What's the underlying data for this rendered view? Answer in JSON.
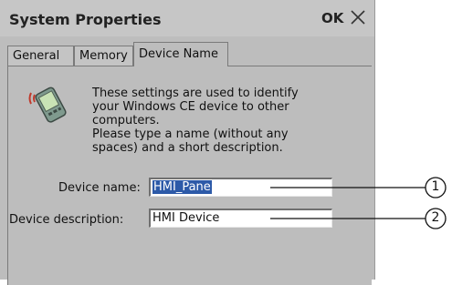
{
  "window": {
    "title": "System Properties",
    "ok_label": "OK",
    "close_icon": "close-icon"
  },
  "tabs": [
    {
      "label": "General",
      "active": false
    },
    {
      "label": "Memory",
      "active": false
    },
    {
      "label": "Device Name",
      "active": true
    }
  ],
  "panel": {
    "icon": "handheld-device-icon",
    "description": "These settings are used to identify your Windows CE device to other computers.\nPlease type a name (without any spaces) and a short description.",
    "device_name_label": "Device name:",
    "device_name_value": "HMI_Pane",
    "device_description_label": "Device description:",
    "device_description_value": "HMI Device"
  },
  "callouts": [
    "1",
    "2"
  ],
  "colors": {
    "selection": "#2d5aa8",
    "window_bg": "#bdbdbd"
  }
}
